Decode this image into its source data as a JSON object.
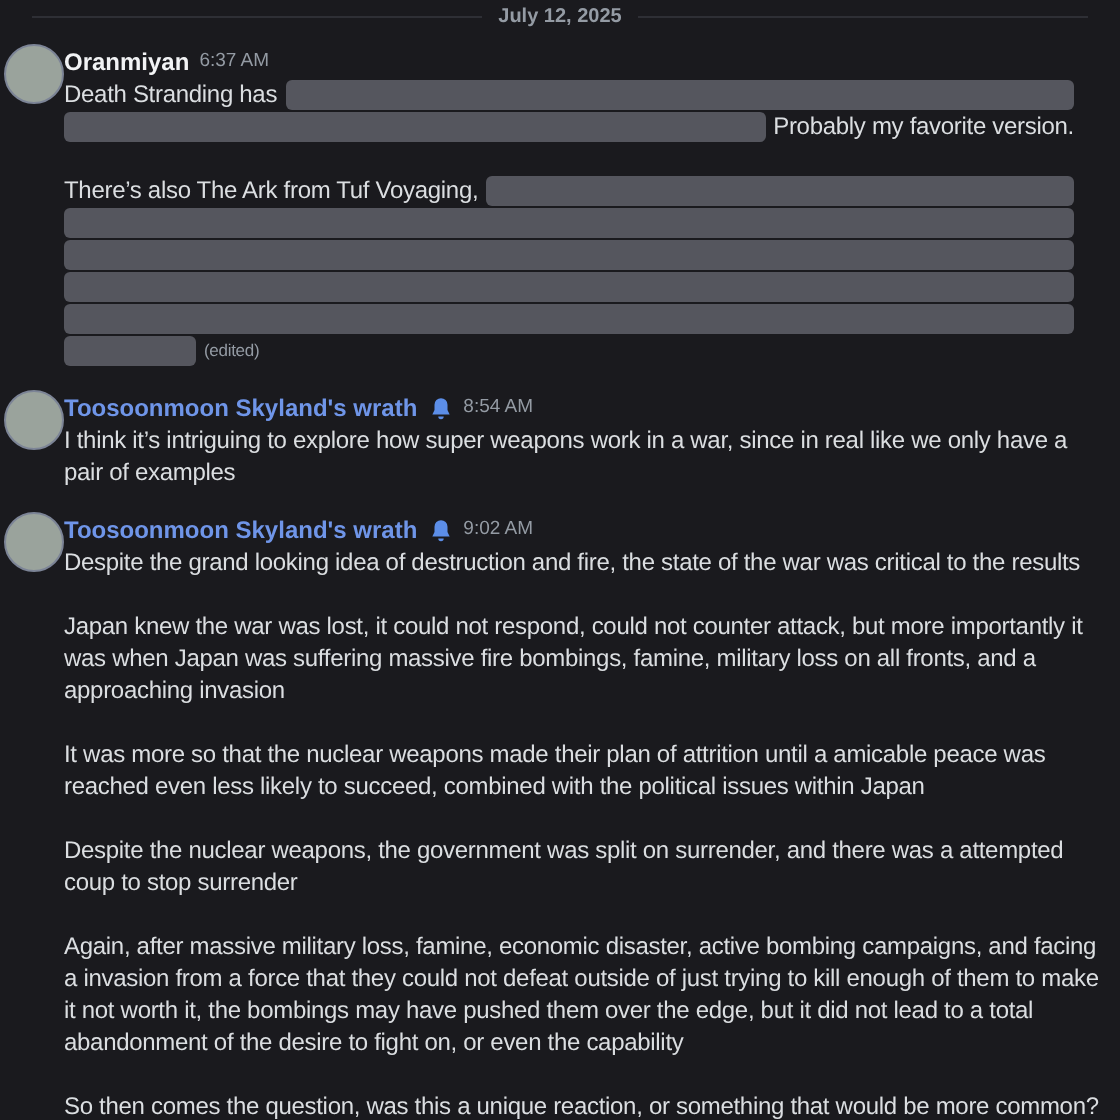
{
  "date_divider": "July 12, 2025",
  "messages": [
    {
      "author": "Oranmiyan",
      "color": "#f2f3f5",
      "time": "6:37 AM",
      "bell": false,
      "blocks": [
        [
          [
            {
              "kind": "text",
              "text": "Death Stranding has"
            },
            {
              "kind": "spoiler"
            }
          ],
          [
            {
              "kind": "spoiler"
            },
            {
              "kind": "text",
              "text": "Probably my favorite version."
            }
          ]
        ],
        [
          [
            {
              "kind": "text",
              "text": "There’s also The Ark from Tuf Voyaging,"
            },
            {
              "kind": "spoiler"
            }
          ],
          [
            {
              "kind": "spoiler"
            }
          ],
          [
            {
              "kind": "spoiler"
            }
          ],
          [
            {
              "kind": "spoiler"
            }
          ],
          [
            {
              "kind": "spoiler"
            }
          ],
          [
            {
              "kind": "spoiler_short"
            },
            {
              "kind": "edited",
              "text": "(edited)"
            }
          ]
        ]
      ]
    },
    {
      "author": "Toosoonmoon Skyland's wrath",
      "color": "#6f95e8",
      "time": "8:54 AM",
      "bell": true,
      "paragraphs": [
        "I think it’s intriguing to explore how super weapons work in a war, since in real like we only have a pair of examples"
      ]
    },
    {
      "author": "Toosoonmoon Skyland's wrath",
      "color": "#6f95e8",
      "time": "9:02 AM",
      "bell": true,
      "paragraphs": [
        "Despite the grand looking idea of destruction and fire, the state of the war was critical to the results",
        "Japan knew the war was lost, it could not respond, could not counter attack, but more importantly it was when Japan was suffering massive fire bombings, famine, military loss on all fronts, and a approaching invasion",
        "It was more so that the nuclear weapons made their plan of attrition until a amicable peace was reached even less likely to succeed, combined with the political issues within Japan",
        "Despite the nuclear weapons, the government was split on surrender, and there was a attempted coup to stop surrender",
        "Again, after massive military loss, famine, economic disaster, active bombing campaigns, and facing a invasion from a force that they could not defeat outside of just trying to kill enough of them to make it not worth it, the bombings may have pushed them over the edge, but it did not lead to a total abandonment of the desire to fight on, or even the capability",
        "So then comes the question, was this a unique reaction, or something that would be more common?"
      ]
    }
  ]
}
